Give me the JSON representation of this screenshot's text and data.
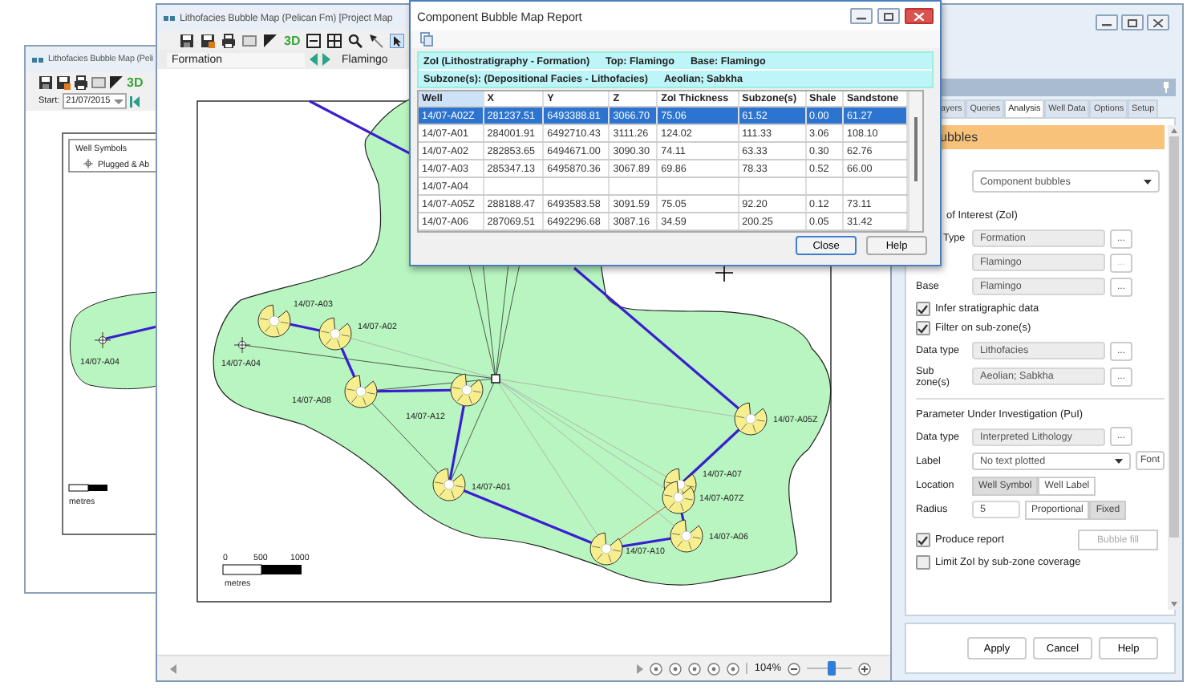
{
  "back_window": {
    "title": "Lithofacies Bubble Map (Peli",
    "toolbar_3d": "3D",
    "start_label": "Start:",
    "start_date": "21/07/2015",
    "legend": {
      "title": "Well Symbols",
      "entry": "Plugged & Ab"
    },
    "well_label": "14/07-A04",
    "scale_unit": "metres"
  },
  "map_window": {
    "title": "Lithofacies Bubble Map (Pelican Fm) [Project Map",
    "toolbar_3d": "3D",
    "zoi_type": "Formation",
    "zoi_value": "Flamingo",
    "wells": [
      {
        "name": "14/07-A03",
        "kind": "bubble"
      },
      {
        "name": "14/07-A02",
        "kind": "bubble"
      },
      {
        "name": "14/07-A04",
        "kind": "plain"
      },
      {
        "name": "14/07-A12",
        "kind": "bubble"
      },
      {
        "name": "14/07-A08",
        "kind": "bubble"
      },
      {
        "name": "14/07-A05Z",
        "kind": "bubble"
      },
      {
        "name": "14/07-A01",
        "kind": "bubble"
      },
      {
        "name": "14/07-A07",
        "kind": "bubble"
      },
      {
        "name": "14/07-A07Z",
        "kind": "bubble"
      },
      {
        "name": "14/07-A06",
        "kind": "bubble"
      },
      {
        "name": "14/07-A10",
        "kind": "bubble"
      }
    ],
    "scale": {
      "labels": [
        "0",
        "500",
        "1000"
      ],
      "unit": "metres"
    },
    "zoom": {
      "reading": "104%",
      "level": 0.55
    }
  },
  "report_dialog": {
    "title": "Component Bubble Map Report",
    "zoi": "ZoI (Lithostratigraphy - Formation)",
    "top": "Top: Flamingo",
    "base": "Base: Flamingo",
    "subzones_label": "Subzone(s): (Depositional Facies - Lithofacies)",
    "subzones": "Aeolian; Sabkha",
    "columns": [
      "Well",
      "X",
      "Y",
      "Z",
      "ZoI Thickness",
      "Subzone(s)",
      "Shale",
      "Sandstone"
    ],
    "rows": [
      {
        "cells": [
          "14/07-A02Z",
          "281237.51",
          "6493388.81",
          "3066.70",
          "75.06",
          "61.52",
          "0.00",
          "61.27"
        ],
        "selected": true
      },
      {
        "cells": [
          "14/07-A01",
          "284001.91",
          "6492710.43",
          "3111.26",
          "124.02",
          "111.33",
          "3.06",
          "108.10"
        ],
        "selected": false
      },
      {
        "cells": [
          "14/07-A02",
          "282853.65",
          "6494671.00",
          "3090.30",
          "74.11",
          "63.33",
          "0.30",
          "62.76"
        ],
        "selected": false
      },
      {
        "cells": [
          "14/07-A03",
          "285347.13",
          "6495870.36",
          "3067.89",
          "69.86",
          "78.33",
          "0.52",
          "66.00"
        ],
        "selected": false
      },
      {
        "cells": [
          "14/07-A04"
        ],
        "selected": false
      },
      {
        "cells": [
          "14/07-A05Z",
          "288188.47",
          "6493583.58",
          "3091.59",
          "75.05",
          "92.20",
          "0.12",
          "73.11"
        ],
        "selected": false
      },
      {
        "cells": [
          "14/07-A06",
          "287069.51",
          "6492296.68",
          "3087.16",
          "34.59",
          "200.25",
          "0.05",
          "31.42"
        ],
        "selected": false
      }
    ],
    "buttons": [
      "Close",
      "Help"
    ]
  },
  "analysis_panel": {
    "tabs": [
      {
        "label": "ayers",
        "selected": false
      },
      {
        "label": "Queries",
        "selected": false
      },
      {
        "label": "Analysis",
        "selected": true
      },
      {
        "label": "Well Data",
        "selected": false
      },
      {
        "label": "Options",
        "selected": false
      },
      {
        "label": "Setup",
        "selected": false
      }
    ],
    "section": "ubbles",
    "bubble_type": "Component bubbles",
    "zoi_heading": "of Interest (ZoI)",
    "zoi_fields": [
      {
        "label": "Type",
        "value": "Formation",
        "browse": "...",
        "disabled": false
      },
      {
        "value": "Flamingo",
        "browse": "...",
        "disabled": true
      },
      {
        "label": "Base",
        "value": "Flamingo",
        "browse": "...",
        "disabled": false
      }
    ],
    "options": [
      {
        "label": "Infer stratigraphic data",
        "checked": true
      },
      {
        "label": "Filter on sub-zone(s)",
        "checked": true
      }
    ],
    "sub_fields": [
      {
        "label": "Data type",
        "value": "Lithofacies",
        "browse": "...",
        "disabled": false
      },
      {
        "label": "Sub zone(s)",
        "value": "Aeolian; Sabkha",
        "browse": "...",
        "disabled": false
      }
    ],
    "pui_heading": "Parameter Under Investigation (PuI)",
    "pui_fields": [
      {
        "label": "Data type",
        "value": "Interpreted Lithology",
        "browse": "...",
        "disabled": false
      }
    ],
    "label_row": {
      "label": "Label",
      "value": "No text plotted",
      "font_button": "Font"
    },
    "location": {
      "label": "Location",
      "options": [
        {
          "label": "Well Symbol",
          "selected": true
        },
        {
          "label": "Well Label",
          "selected": false
        }
      ]
    },
    "radius": {
      "label": "Radius",
      "value": "5",
      "options": [
        {
          "label": "Proportional",
          "selected": false
        },
        {
          "label": "Fixed",
          "selected": true
        }
      ]
    },
    "produce_report": {
      "label": "Produce report",
      "checked": true
    },
    "bubble_fill": {
      "label": "Bubble fill",
      "disabled": true
    },
    "limit": {
      "label": "Limit ZoI by sub-zone coverage",
      "checked": false
    },
    "buttons": [
      "Apply",
      "Cancel",
      "Help"
    ]
  }
}
